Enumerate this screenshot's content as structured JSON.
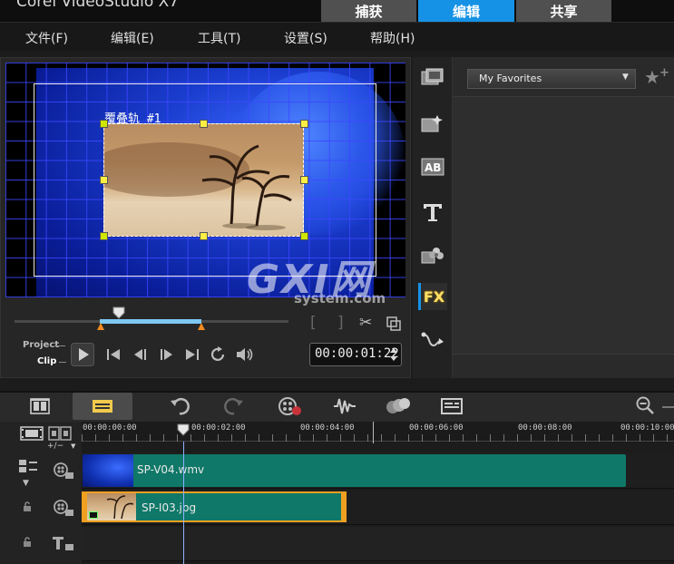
{
  "app": {
    "title": "Corel VideoStudio X7",
    "modes": [
      "捕获",
      "编辑",
      "共享"
    ],
    "active_mode": "编辑"
  },
  "menu": {
    "items": [
      "文件(F)",
      "编辑(E)",
      "工具(T)",
      "设置(S)",
      "帮助(H)"
    ]
  },
  "player": {
    "overlay_track_label": "覆叠轨 #1",
    "mode_project": "Project",
    "mode_clip": "Clip",
    "timecode": "00:00:01:22",
    "trim_in": "[",
    "trim_out": "]"
  },
  "library": {
    "selected_folder": "My Favorites",
    "tools": [
      "media-icon",
      "instant-project-icon",
      "transition-icon",
      "title-icon",
      "graphic-icon",
      "fx-icon",
      "path-icon"
    ],
    "fx_label": "FX",
    "active_tool": "fx-icon"
  },
  "timeline": {
    "ruler_labels": [
      "00:00:00:00",
      "00:00:02:00",
      "00:00:04:00",
      "00:00:06:00",
      "00:00:08:00",
      "00:00:10:00"
    ],
    "add_remove_label": "+/−",
    "clips": {
      "video": "SP-V04.wmv",
      "overlay": "SP-I03.jpg"
    }
  },
  "watermark": {
    "logo": "GXI网",
    "domain": "system.com"
  },
  "colors": {
    "accent": "#1592e6",
    "clip": "#0f7868",
    "selection": "#f0a020",
    "handle": "#ffee44"
  }
}
